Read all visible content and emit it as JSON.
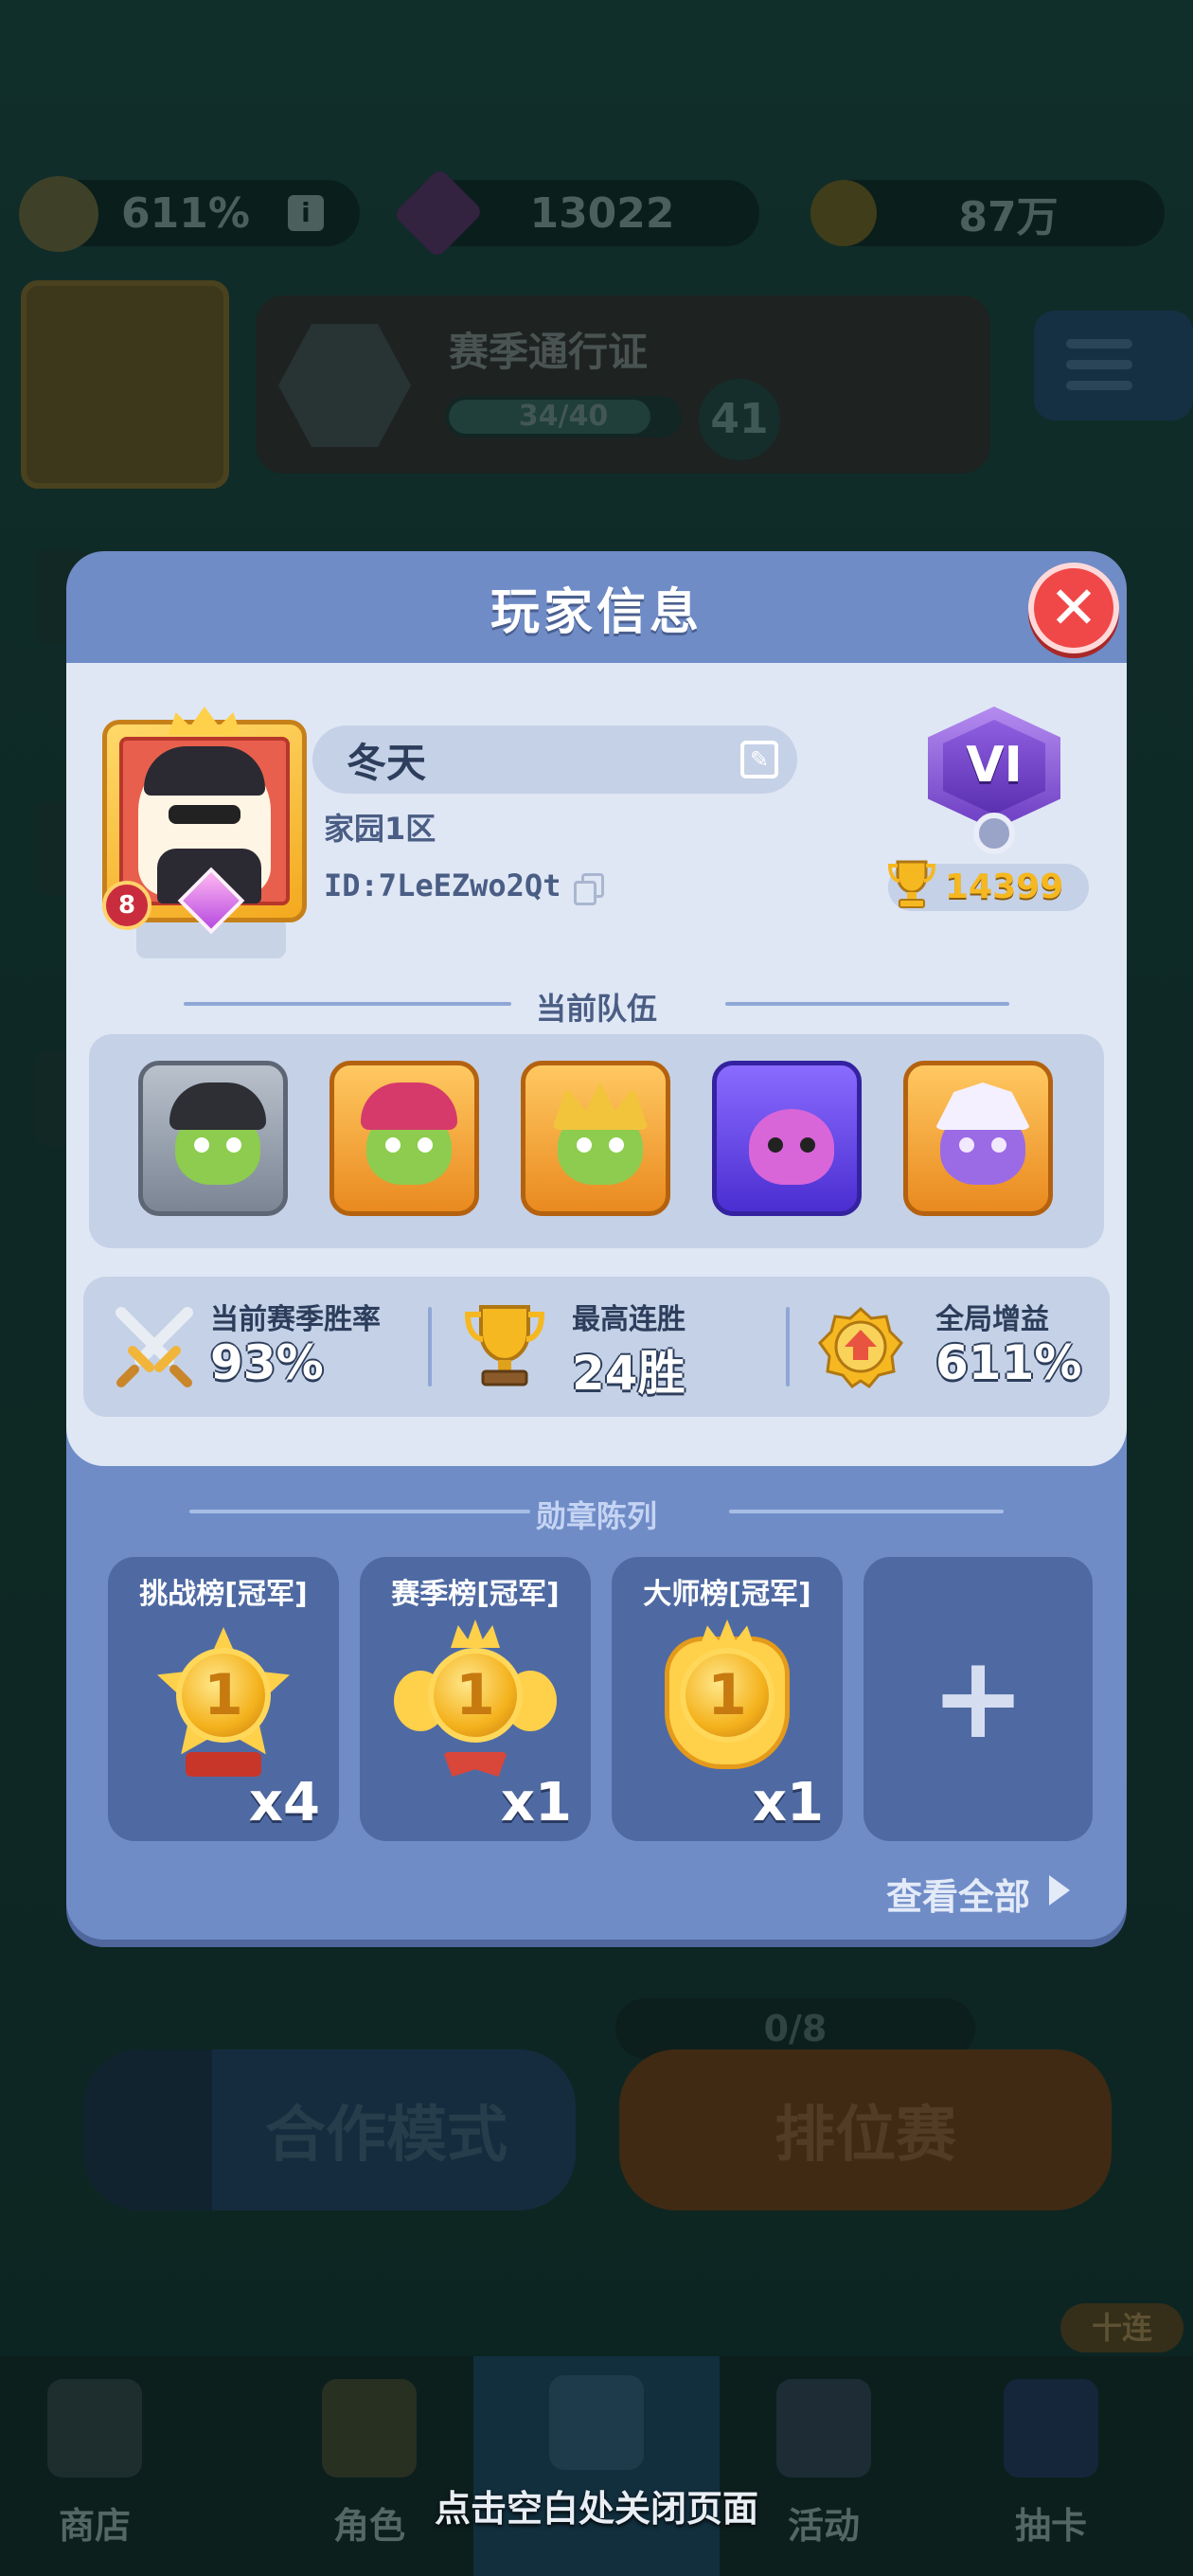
{
  "hud": {
    "boost_percent": "611%",
    "gems": "13022",
    "gold": "87万"
  },
  "season_pass": {
    "title": "赛季通行证",
    "progress_text": "34/40",
    "progress": 0.85,
    "level": "41"
  },
  "lobby": {
    "queue_text": "0/8",
    "coop_button": "合作模式",
    "ranked_button": "排位赛",
    "ten_pull_badge": "十连"
  },
  "dialog": {
    "title": "玩家信息",
    "player": {
      "name": "冬天",
      "server": "家园1区",
      "id": "ID:7LeEZwo2Qt",
      "level": "8",
      "rank": "VI",
      "trophies": "14399"
    },
    "team": {
      "label": "当前队伍",
      "heroes": [
        {
          "name": "hero-goblin-helmet"
        },
        {
          "name": "hero-goblin-mech"
        },
        {
          "name": "hero-goblin-king"
        },
        {
          "name": "hero-pink-brute"
        },
        {
          "name": "hero-shadow-spirit"
        }
      ]
    },
    "stats": [
      {
        "label": "当前赛季胜率",
        "value": "93%",
        "icon": "swords-icon"
      },
      {
        "label": "最高连胜",
        "value": "24胜",
        "icon": "trophy-icon"
      },
      {
        "label": "全局增益",
        "value": "611%",
        "icon": "boost-icon"
      }
    ],
    "medals": {
      "label": "勋章陈列",
      "items": [
        {
          "title": "挑战榜[冠军]",
          "count": "x4"
        },
        {
          "title": "赛季榜[冠军]",
          "count": "x1"
        },
        {
          "title": "大师榜[冠军]",
          "count": "x1"
        }
      ],
      "add_icon": "plus-icon",
      "view_all": "查看全部"
    }
  },
  "bottom_nav": [
    {
      "label": "商店",
      "icon": "shop-icon"
    },
    {
      "label": "角色",
      "icon": "character-icon"
    },
    {
      "label": "",
      "icon": "battle-icon"
    },
    {
      "label": "活动",
      "icon": "event-icon"
    },
    {
      "label": "抽卡",
      "icon": "card-draw-icon"
    }
  ],
  "hint": "点击空白处关闭页面",
  "colors": {
    "dialog_bg": "#6f8cc7",
    "panel_bg": "#dfe7f5",
    "close_red": "#f04848",
    "trophy_gold": "#f6b821"
  }
}
